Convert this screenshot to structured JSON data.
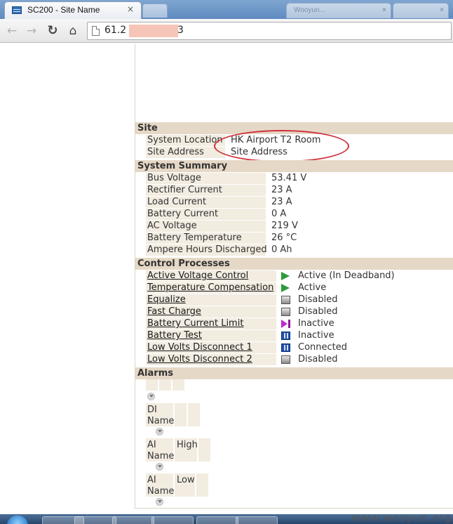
{
  "browser": {
    "tab_title": "SC200 - Site Name",
    "tab_close": "×",
    "other_tabs": [
      {
        "label": "Wooyun...",
        "close": "×"
      },
      {
        "label": "",
        "close": "×"
      }
    ],
    "url_prefix": "61.2",
    "url_suffix": "3"
  },
  "site": {
    "heading": "Site",
    "rows": [
      {
        "label": "System Location",
        "value": "HK Airport T2 Room"
      },
      {
        "label": "Site Address",
        "value": "Site Address"
      }
    ]
  },
  "summary": {
    "heading": "System Summary",
    "rows": [
      {
        "label": "Bus Voltage",
        "value": "53.41 V"
      },
      {
        "label": "Rectifier Current",
        "value": "23 A"
      },
      {
        "label": "Load Current",
        "value": "23 A"
      },
      {
        "label": "Battery Current",
        "value": "0 A"
      },
      {
        "label": "AC Voltage",
        "value": "219 V"
      },
      {
        "label": "Battery Temperature",
        "value": "26 °C"
      },
      {
        "label": "Ampere Hours Discharged",
        "value": "0 Ah"
      }
    ]
  },
  "control": {
    "heading": "Control Processes",
    "rows": [
      {
        "label": "Active Voltage Control",
        "status": "Active (In Deadband)",
        "icon": "play-icon"
      },
      {
        "label": "Temperature Compensation",
        "status": "Active",
        "icon": "play-icon"
      },
      {
        "label": "Equalize",
        "status": "Disabled",
        "icon": "stop-icon"
      },
      {
        "label": "Fast Charge",
        "status": "Disabled",
        "icon": "stop-icon"
      },
      {
        "label": "Battery Current Limit",
        "status": "Inactive",
        "icon": "skip-icon"
      },
      {
        "label": "Battery Test",
        "status": "Inactive",
        "icon": "pause-icon"
      },
      {
        "label": "Low Volts Disconnect 1",
        "status": "Connected",
        "icon": "pause-icon"
      },
      {
        "label": "Low Volts Disconnect 2",
        "status": "Disabled",
        "icon": "stop-icon"
      }
    ]
  },
  "alarms": {
    "heading": "Alarms",
    "di_name": "DI\nName",
    "ai_high_name": "AI\nName",
    "ai_high": "High",
    "ai_low_name": "AI\nName",
    "ai_low": "Low"
  },
  "watermark": "www.wooyun.org",
  "colors": {
    "section_bg": "#e5d8c6",
    "label_bg": "#f2ece1",
    "annotation": "#d0303a",
    "active_icon": "#2f9a3a"
  }
}
